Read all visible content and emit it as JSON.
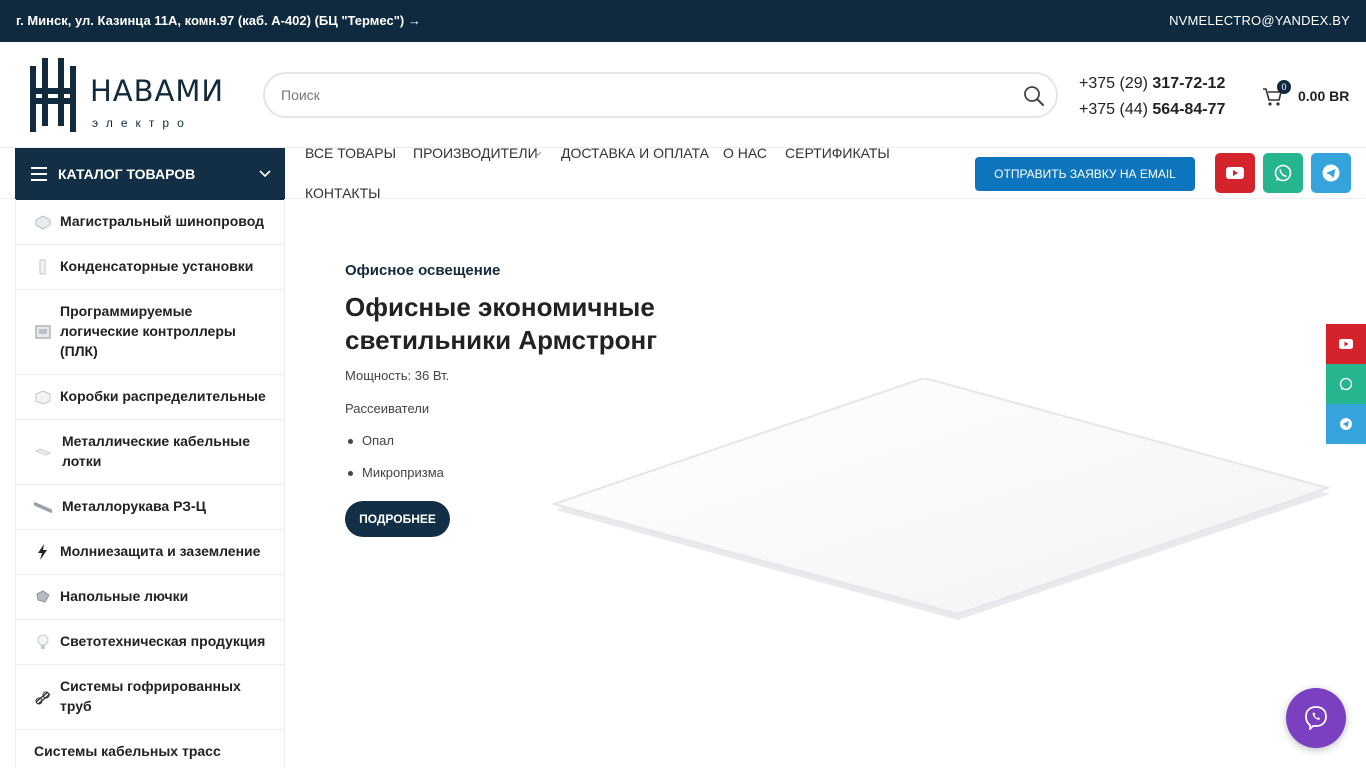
{
  "topbar": {
    "address": "г. Минск, ул. Казинца 11А, комн.97 (каб. А-402) (БЦ \"Термес\") →",
    "email": "NVMELECTRO@YANDEX.BY"
  },
  "header": {
    "logo_word": "НАВАМИ",
    "logo_sub": "электро",
    "search_placeholder": "Поиск",
    "phone1_prefix": "+375 (29) ",
    "phone1_number": "317-72-12",
    "phone2_prefix": "+375 (44) ",
    "phone2_number": "564-84-77",
    "cart_count": "0",
    "cart_total": "0.00 BR"
  },
  "nav": {
    "catalog_label": "КАТАЛОГ ТОВАРОВ",
    "items": [
      "ВСЕ ТОВАРЫ",
      "ПРОИЗВОДИТЕЛИ",
      "ДОСТАВКА И ОПЛАТА",
      "О НАС",
      "СЕРТИФИКАТЫ",
      "КОНТАКТЫ"
    ],
    "send_button": "ОТПРАВИТЬ ЗАЯВКУ НА EMAIL"
  },
  "sidebar": {
    "items": [
      "Магистральный шинопровод",
      "Конденсаторные установки",
      "Программируемые логические контроллеры (ПЛК)",
      "Коробки распределительные",
      "Металлические кабельные лотки",
      "Металлорукава РЗ-Ц",
      "Молниезащита и заземление",
      "Напольные лючки",
      "Светотехническая продукция",
      "Системы гофрированных труб",
      "Системы кабельных трасс"
    ]
  },
  "hero": {
    "category": "Офисное освещение",
    "title": "Офисные экономичные светильники Армстронг",
    "power": "Мощность: 36 Вт.",
    "diffusers_label": "Рассеиватели",
    "diffusers": [
      "Опал",
      "Микропризма"
    ],
    "more_button": "ПОДРОБНЕЕ"
  },
  "colors": {
    "dark_navy": "#0f2a3f",
    "blue_button": "#0d75be",
    "youtube": "#d4232b",
    "whatsapp": "#25b58f",
    "telegram": "#35a3dc",
    "viber": "#7b3fc2"
  }
}
